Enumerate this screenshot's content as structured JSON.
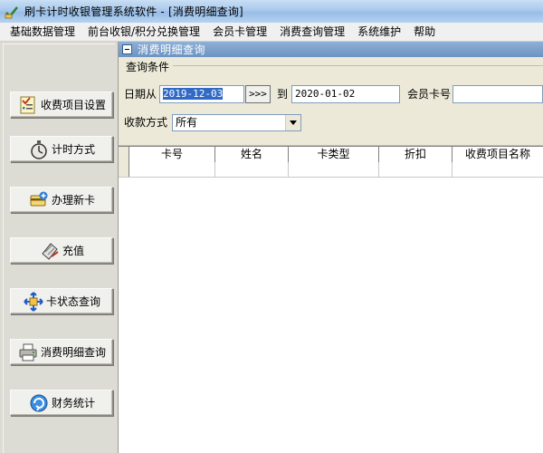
{
  "window": {
    "title": "刷卡计时收银管理系统软件  - [消费明细查询]"
  },
  "menu": [
    "基础数据管理",
    "前台收银/积分兑换管理",
    "会员卡管理",
    "消费查询管理",
    "系统维护",
    "帮助"
  ],
  "nav": {
    "items": [
      {
        "label": "收费项目设置",
        "icon": "checklist-icon"
      },
      {
        "label": "计时方式",
        "icon": "stopwatch-icon"
      },
      {
        "label": "办理新卡",
        "icon": "new-card-icon"
      },
      {
        "label": "充值",
        "icon": "recharge-icon"
      },
      {
        "label": "卡状态查询",
        "icon": "card-status-icon"
      },
      {
        "label": "消费明细查询",
        "icon": "printer-icon"
      },
      {
        "label": "财务统计",
        "icon": "finance-icon"
      }
    ]
  },
  "panel": {
    "title": "消费明细查询"
  },
  "query": {
    "legend": "查询条件",
    "date_from_label": "日期从",
    "date_from": "2019-12-03",
    "range_button": ">>>",
    "date_to_label": "到",
    "date_to": "2020-01-02",
    "card_no_label": "会员卡号",
    "card_no": "",
    "pay_method_label": "收款方式",
    "pay_method": "所有"
  },
  "grid": {
    "columns": [
      "卡号",
      "姓名",
      "卡类型",
      "折扣",
      "收费项目名称"
    ]
  },
  "colors": {
    "selection": "#316ac5",
    "panel_header": "#7d9fcb"
  }
}
